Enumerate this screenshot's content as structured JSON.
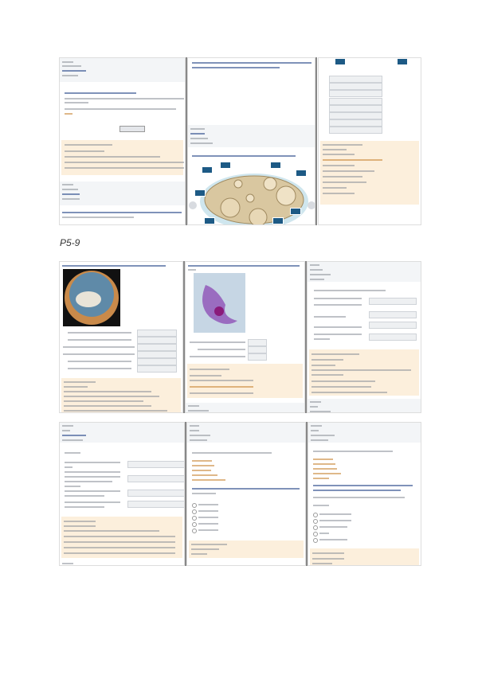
{
  "section_label": "P5-9",
  "colors": {
    "feedback": "#fcefdc",
    "header": "#f3f5f7",
    "tag": "#1d5a85"
  }
}
